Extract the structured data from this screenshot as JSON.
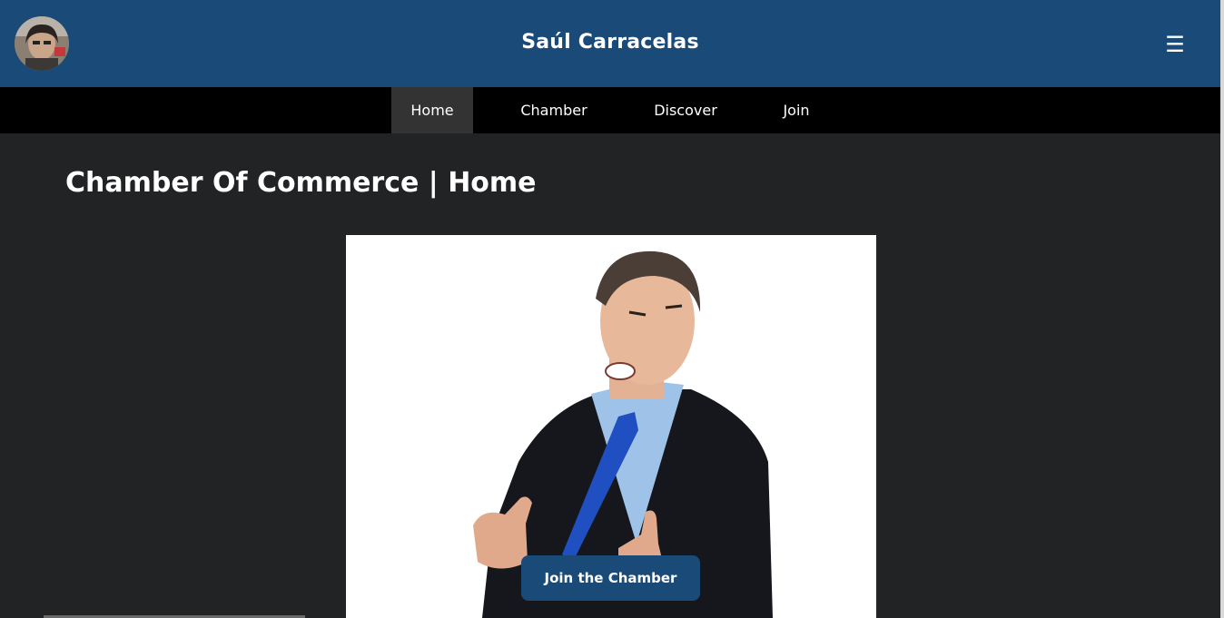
{
  "header": {
    "title": "Saúl Carracelas",
    "menu_icon": "☰",
    "colors": {
      "background": "#1a4a78",
      "text": "#ffffff"
    }
  },
  "nav": {
    "items": [
      {
        "label": "Home",
        "active": true
      },
      {
        "label": "Chamber",
        "active": false
      },
      {
        "label": "Discover",
        "active": false
      },
      {
        "label": "Join",
        "active": false
      }
    ],
    "colors": {
      "background": "#000000",
      "active": "#333333"
    }
  },
  "main": {
    "title": "Chamber Of Commerce | Home",
    "hero": {
      "cta_label": "Join the Chamber"
    }
  },
  "icons": {
    "avatar": "avatar-photo",
    "menu": "hamburger-menu-icon"
  },
  "colors": {
    "page_background": "#222325",
    "accent": "#1a4a78"
  }
}
